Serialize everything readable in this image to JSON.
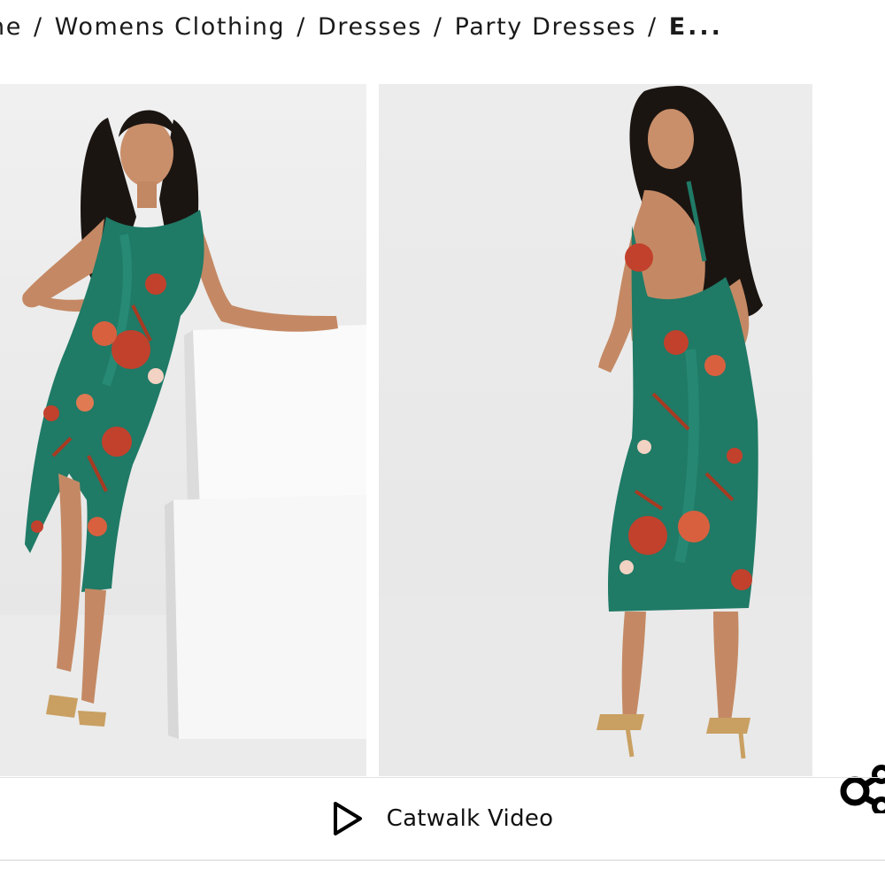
{
  "breadcrumb": {
    "items": [
      "ne",
      "Womens Clothing",
      "Dresses",
      "Party Dresses"
    ],
    "current": "E...",
    "separator": "/"
  },
  "gallery": {
    "images": [
      {
        "alt": "front view"
      },
      {
        "alt": "back view"
      }
    ]
  },
  "share": {
    "icon": "share-icon"
  },
  "video": {
    "label": "Catwalk Video",
    "icon": "play-icon"
  },
  "colors": {
    "dress": "#1f7a66",
    "accent": "#c2412c",
    "background": "#ececec"
  }
}
